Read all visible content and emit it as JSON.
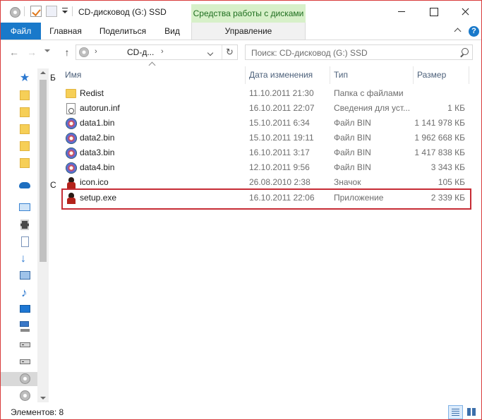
{
  "window": {
    "title": "CD-дисковод (G:) SSD",
    "contextual_tab_header": "Средства работы с дисками"
  },
  "ribbon": {
    "tabs": [
      {
        "label": "Файл"
      },
      {
        "label": "Главная"
      },
      {
        "label": "Поделиться"
      },
      {
        "label": "Вид"
      },
      {
        "label": "Управление"
      }
    ],
    "help_label": "?"
  },
  "address": {
    "path": "CD-д...",
    "search_placeholder": "Поиск: CD-дисковод (G:) SSD"
  },
  "navpane": {
    "items": [
      {
        "icon": "star-icon",
        "label": "Б"
      },
      {
        "icon": "folder-icon"
      },
      {
        "icon": "folder-icon"
      },
      {
        "icon": "folder-icon"
      },
      {
        "icon": "folder-icon"
      },
      {
        "icon": "folder-icon"
      },
      {
        "icon": "cloud-icon",
        "label": "C"
      },
      {
        "icon": "pc-icon"
      },
      {
        "icon": "film-icon"
      },
      {
        "icon": "doc-icon"
      },
      {
        "icon": "download-icon"
      },
      {
        "icon": "picture-icon"
      },
      {
        "icon": "music-icon"
      },
      {
        "icon": "desktop-icon"
      },
      {
        "icon": "network-drive-icon"
      },
      {
        "icon": "drive-icon"
      },
      {
        "icon": "drive-icon"
      },
      {
        "icon": "cd-drive-icon"
      },
      {
        "icon": "cd-drive-icon"
      }
    ]
  },
  "columns": {
    "name": "Имя",
    "date": "Дата изменения",
    "type": "Тип",
    "size": "Размер"
  },
  "files": [
    {
      "name": "Redist",
      "date": "11.10.2011 21:30",
      "type": "Папка с файлами",
      "size": "",
      "icon": "folder-icon"
    },
    {
      "name": "autorun.inf",
      "date": "16.10.2011 22:07",
      "type": "Сведения для уст...",
      "size": "1 КБ",
      "icon": "inf-file-icon"
    },
    {
      "name": "data1.bin",
      "date": "15.10.2011 6:34",
      "type": "Файл BIN",
      "size": "1 141 978 КБ",
      "icon": "bin-file-icon"
    },
    {
      "name": "data2.bin",
      "date": "15.10.2011 19:11",
      "type": "Файл BIN",
      "size": "1 962 668 КБ",
      "icon": "bin-file-icon"
    },
    {
      "name": "data3.bin",
      "date": "16.10.2011 3:17",
      "type": "Файл BIN",
      "size": "1 417 838 КБ",
      "icon": "bin-file-icon"
    },
    {
      "name": "data4.bin",
      "date": "12.10.2011 9:56",
      "type": "Файл BIN",
      "size": "3 343 КБ",
      "icon": "bin-file-icon"
    },
    {
      "name": "icon.ico",
      "date": "26.08.2010 2:38",
      "type": "Значок",
      "size": "105 КБ",
      "icon": "ico-file-icon"
    },
    {
      "name": "setup.exe",
      "date": "16.10.2011 22:06",
      "type": "Приложение",
      "size": "2 339 КБ",
      "icon": "exe-file-icon"
    }
  ],
  "status": {
    "count_text": "Элементов: 8"
  },
  "colors": {
    "file_tab": "#1979ca",
    "contextual_tab": "#d7f0c9",
    "highlight": "#c62c35",
    "window_border": "#d83b3b"
  }
}
